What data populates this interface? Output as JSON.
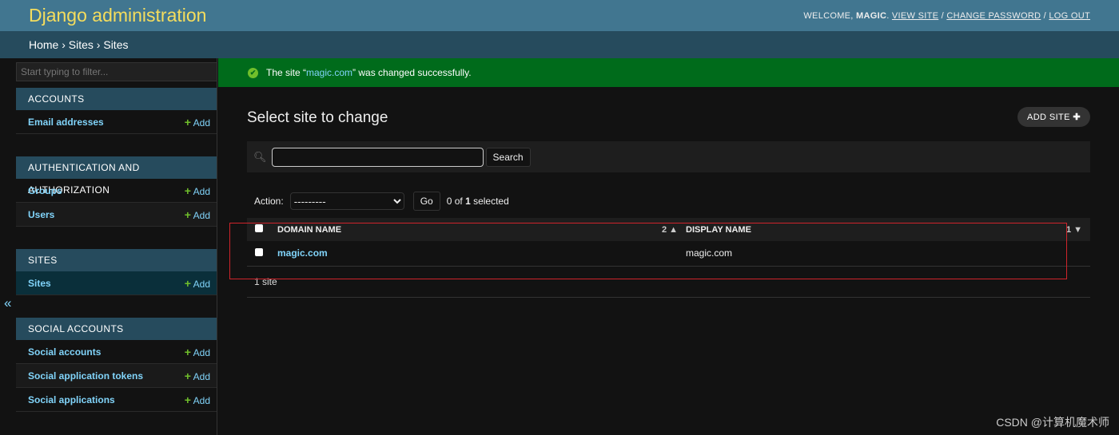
{
  "header": {
    "brand": "Django administration",
    "welcome": "Welcome,",
    "user": "magic",
    "view_site": "View site",
    "change_password": "Change password",
    "logout": "Log out"
  },
  "breadcrumb": "Home › Sites › Sites",
  "sidebar": {
    "filter_placeholder": "Start typing to filter...",
    "add_label": "Add",
    "toggle": "«",
    "apps": [
      {
        "name": "ACCOUNTS",
        "models": [
          "Email addresses"
        ]
      },
      {
        "name": "AUTHENTICATION AND AUTHORIZATION",
        "models": [
          "Groups",
          "Users"
        ]
      },
      {
        "name": "SITES",
        "models": [
          "Sites"
        ]
      },
      {
        "name": "SOCIAL ACCOUNTS",
        "models": [
          "Social accounts",
          "Social application tokens",
          "Social applications"
        ]
      }
    ]
  },
  "message": {
    "pre": "The site “",
    "link": "magic.com",
    "post": "” was changed successfully."
  },
  "main": {
    "title": "Select site to change",
    "add_button": "ADD SITE",
    "search_button": "Search",
    "search_value": "",
    "action_label": "Action:",
    "action_selected": "---------",
    "go": "Go",
    "selection_pre": "0 of ",
    "selection_num": "1",
    "selection_post": " selected",
    "columns": [
      {
        "label": "Domain name",
        "sort": "2 ▲"
      },
      {
        "label": "Display name",
        "sort": "1 ▼"
      }
    ],
    "rows": [
      {
        "domain": "magic.com",
        "display": "magic.com"
      }
    ],
    "count": "1 site"
  },
  "watermark": "CSDN @计算机魔术师",
  "colors": {
    "header": "#417690",
    "breadcrumb": "#264b5d",
    "success": "#006b1b",
    "link": "#81d4fa",
    "brand": "#f5dd5d",
    "highlight": "#d0242b"
  }
}
